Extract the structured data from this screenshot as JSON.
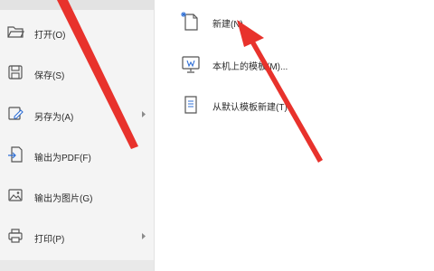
{
  "file_menu": {
    "items": [
      {
        "label": "打开(O)",
        "icon": "folder-open-icon",
        "has_submenu": false
      },
      {
        "label": "保存(S)",
        "icon": "save-icon",
        "has_submenu": false
      },
      {
        "label": "另存为(A)",
        "icon": "save-as-icon",
        "has_submenu": true
      },
      {
        "label": "输出为PDF(F)",
        "icon": "export-pdf-icon",
        "has_submenu": false
      },
      {
        "label": "输出为图片(G)",
        "icon": "export-image-icon",
        "has_submenu": false
      },
      {
        "label": "打印(P)",
        "icon": "printer-icon",
        "has_submenu": true
      }
    ]
  },
  "new_panel": {
    "items": [
      {
        "label": "新建(N)",
        "icon": "new-document-icon"
      },
      {
        "label": "本机上的模板(M)...",
        "icon": "local-template-icon"
      },
      {
        "label": "从默认模板新建(T)",
        "icon": "default-template-icon"
      }
    ]
  },
  "annotation": {
    "arrow_color": "#e8322c"
  }
}
